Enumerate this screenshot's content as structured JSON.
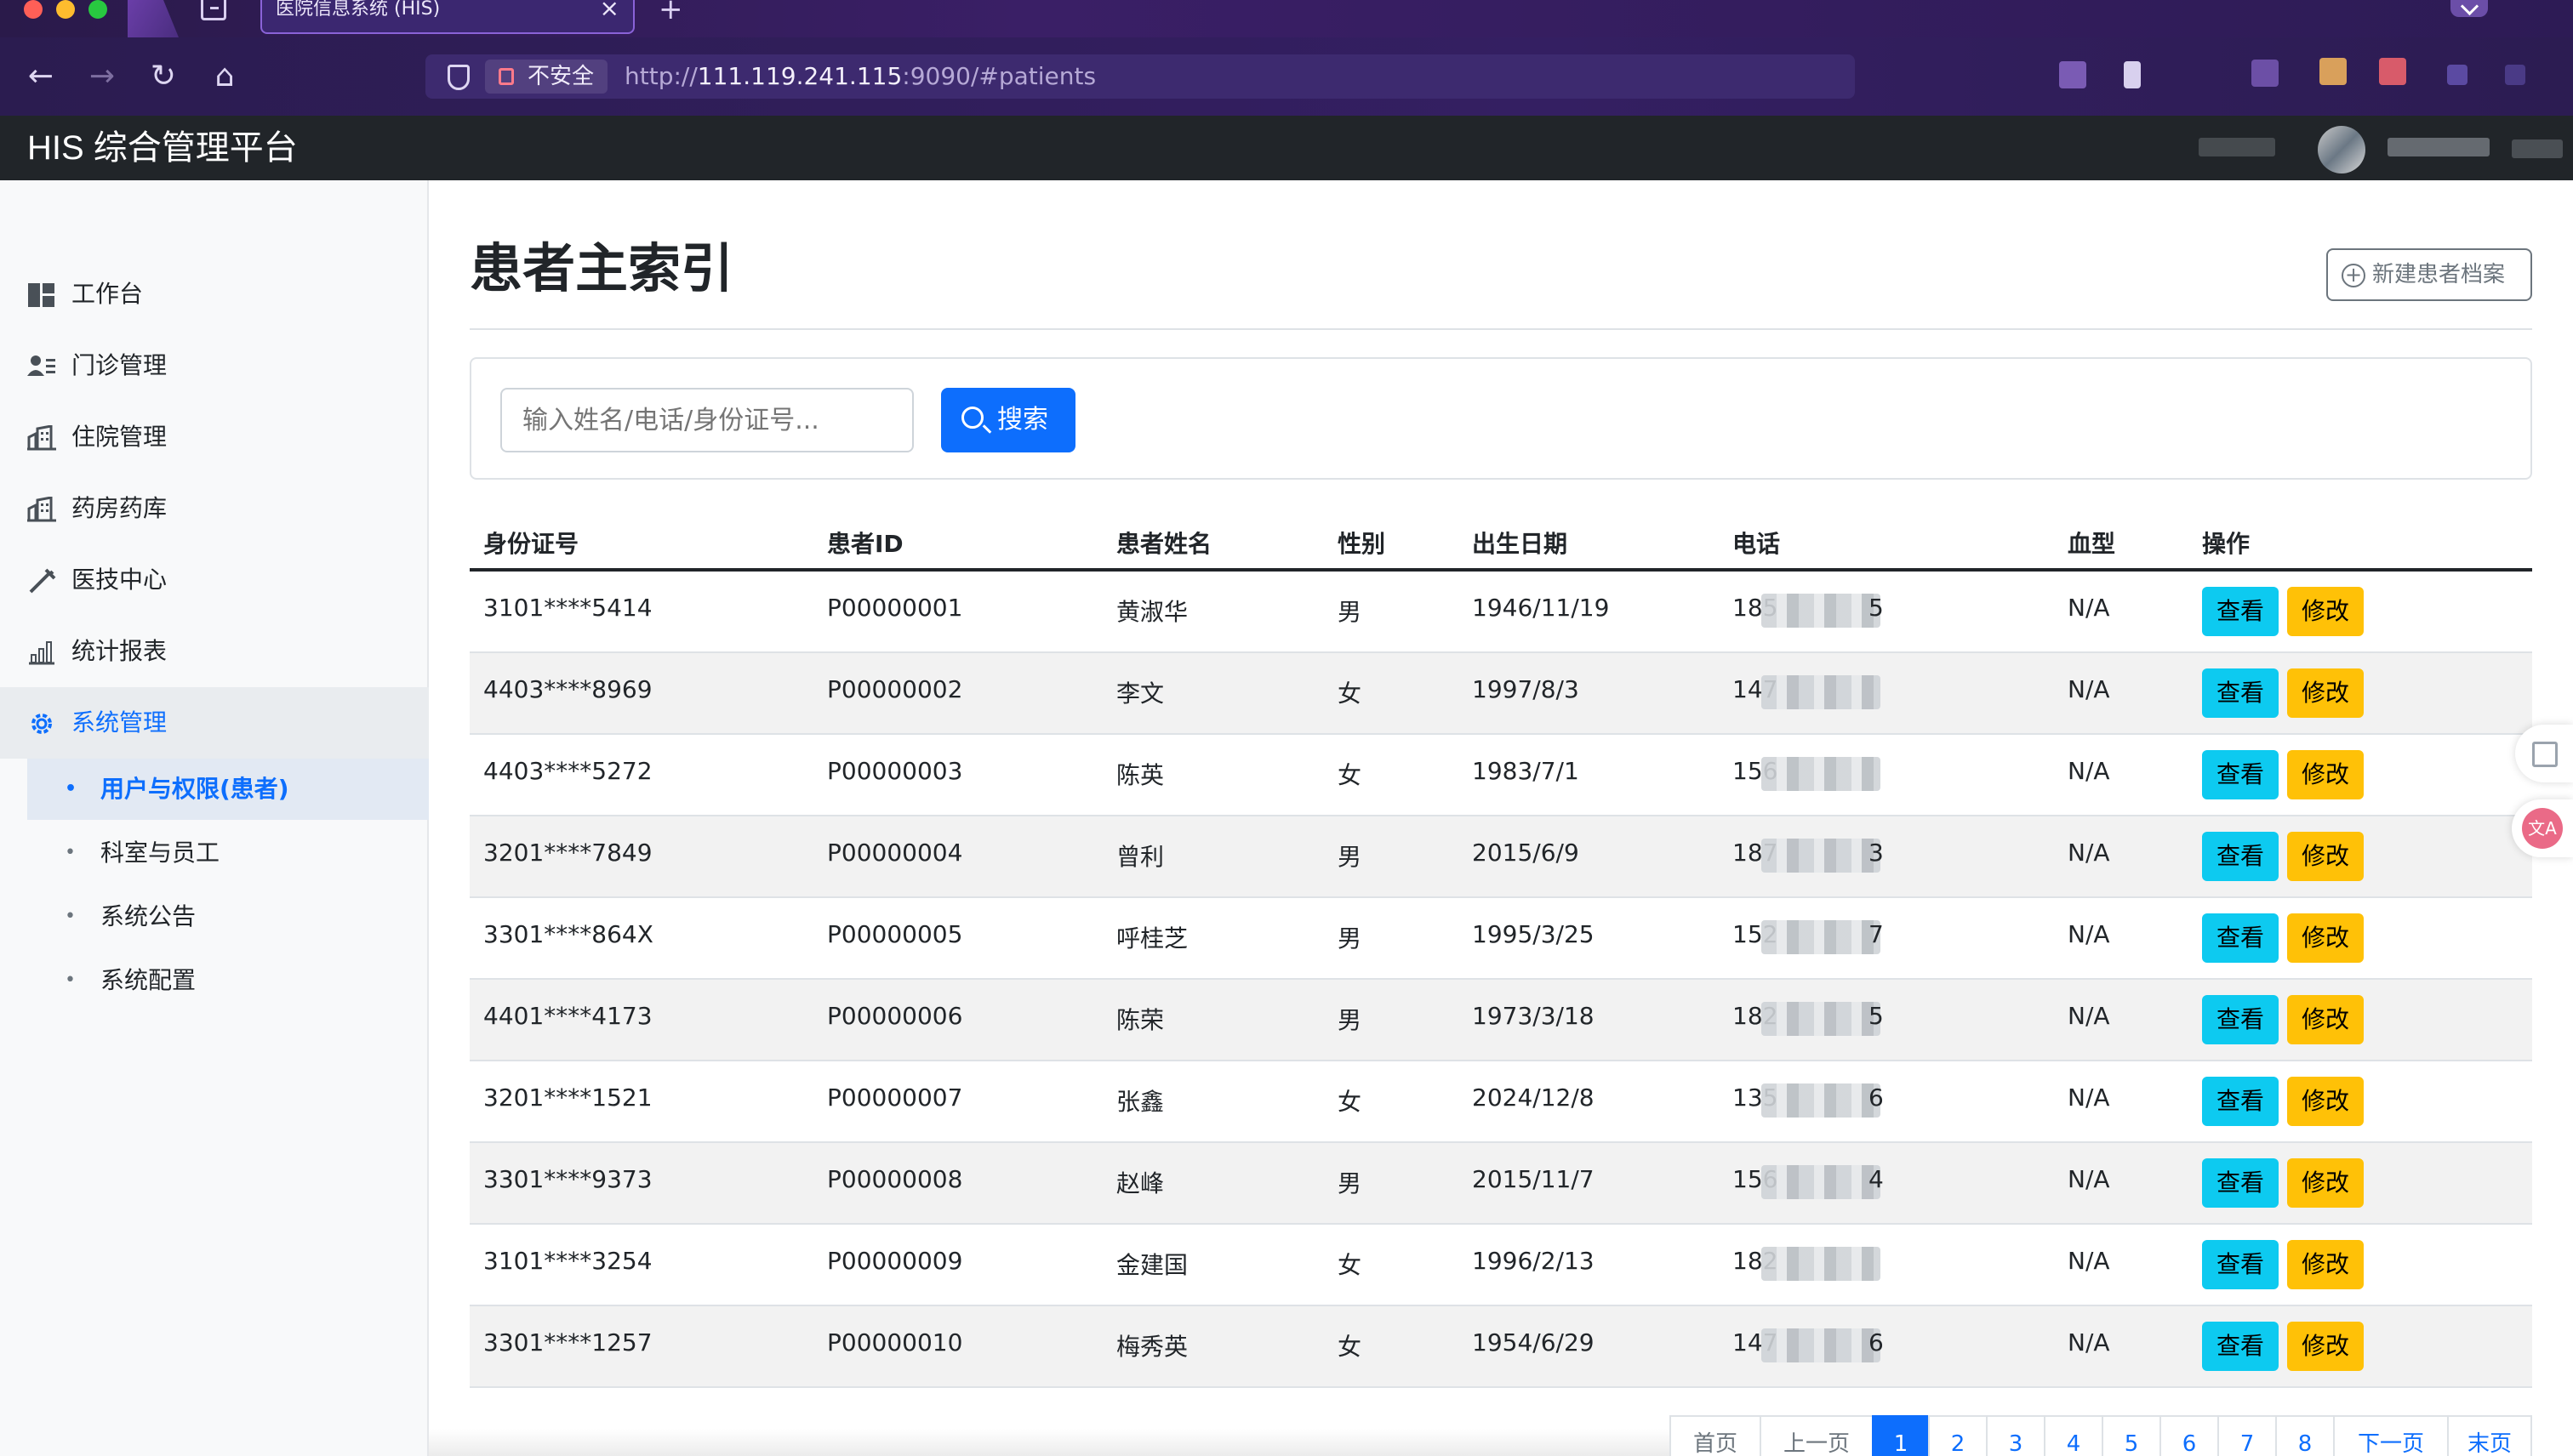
{
  "browser": {
    "tab_title": "医院信息系统 (HIS)",
    "tab_close": "×",
    "new_tab": "+",
    "security_label": "不安全",
    "url_scheme": "http://",
    "url_host": "111.119.241.115",
    "url_rest": ":9090/#patients",
    "nav_icons": {
      "back": "←",
      "forward": "→",
      "reload": "↻",
      "home": "⌂"
    }
  },
  "app": {
    "brand": "HIS 综合管理平台"
  },
  "sidebar": {
    "items": [
      {
        "label": "工作台",
        "icon": "dashboard-icon"
      },
      {
        "label": "门诊管理",
        "icon": "people-list-icon"
      },
      {
        "label": "住院管理",
        "icon": "building-icon"
      },
      {
        "label": "药房药库",
        "icon": "building-icon"
      },
      {
        "label": "医技中心",
        "icon": "syringe-icon"
      },
      {
        "label": "统计报表",
        "icon": "bar-chart-icon"
      },
      {
        "label": "系统管理",
        "icon": "gear-icon"
      }
    ],
    "sub_items": [
      {
        "label": "用户与权限(患者)"
      },
      {
        "label": "科室与员工"
      },
      {
        "label": "系统公告"
      },
      {
        "label": "系统配置"
      }
    ],
    "bullet": "•"
  },
  "main": {
    "title": "患者主索引",
    "new_button": "新建患者档案",
    "search_placeholder": "输入姓名/电话/身份证号...",
    "search_button": "搜索"
  },
  "table": {
    "headers": [
      "身份证号",
      "患者ID",
      "患者姓名",
      "性别",
      "出生日期",
      "电话",
      "血型",
      "操作"
    ],
    "view_label": "查看",
    "edit_label": "修改",
    "rows": [
      {
        "id_card": "3101****5414",
        "pid": "P00000001",
        "name": "黄淑华",
        "gender": "男",
        "dob": "1946/11/19",
        "phone_prefix": "185",
        "phone_suffix": "5",
        "blood": "N/A"
      },
      {
        "id_card": "4403****8969",
        "pid": "P00000002",
        "name": "李文",
        "gender": "女",
        "dob": "1997/8/3",
        "phone_prefix": "147",
        "phone_suffix": "",
        "blood": "N/A"
      },
      {
        "id_card": "4403****5272",
        "pid": "P00000003",
        "name": "陈英",
        "gender": "女",
        "dob": "1983/7/1",
        "phone_prefix": "156",
        "phone_suffix": "",
        "blood": "N/A"
      },
      {
        "id_card": "3201****7849",
        "pid": "P00000004",
        "name": "曾利",
        "gender": "男",
        "dob": "2015/6/9",
        "phone_prefix": "187",
        "phone_suffix": "3",
        "blood": "N/A"
      },
      {
        "id_card": "3301****864X",
        "pid": "P00000005",
        "name": "呼桂芝",
        "gender": "男",
        "dob": "1995/3/25",
        "phone_prefix": "152",
        "phone_suffix": "7",
        "blood": "N/A"
      },
      {
        "id_card": "4401****4173",
        "pid": "P00000006",
        "name": "陈荣",
        "gender": "男",
        "dob": "1973/3/18",
        "phone_prefix": "182",
        "phone_suffix": "5",
        "blood": "N/A"
      },
      {
        "id_card": "3201****1521",
        "pid": "P00000007",
        "name": "张鑫",
        "gender": "女",
        "dob": "2024/12/8",
        "phone_prefix": "135",
        "phone_suffix": "6",
        "blood": "N/A"
      },
      {
        "id_card": "3301****9373",
        "pid": "P00000008",
        "name": "赵峰",
        "gender": "男",
        "dob": "2015/11/7",
        "phone_prefix": "156",
        "phone_suffix": "4",
        "blood": "N/A"
      },
      {
        "id_card": "3101****3254",
        "pid": "P00000009",
        "name": "金建国",
        "gender": "女",
        "dob": "1996/2/13",
        "phone_prefix": "182",
        "phone_suffix": "",
        "blood": "N/A"
      },
      {
        "id_card": "3301****1257",
        "pid": "P00000010",
        "name": "梅秀英",
        "gender": "女",
        "dob": "1954/6/29",
        "phone_prefix": "147",
        "phone_suffix": "6",
        "blood": "N/A"
      }
    ]
  },
  "pagination": {
    "first": "首页",
    "prev": "上一页",
    "pages": [
      "1",
      "2",
      "3",
      "4",
      "5",
      "6",
      "7",
      "8"
    ],
    "current": "1",
    "next": "下一页",
    "last": "末页"
  },
  "colors": {
    "primary": "#0d6efd",
    "info": "#0dcaf0",
    "warning": "#ffc107",
    "header_dark": "#212529"
  }
}
